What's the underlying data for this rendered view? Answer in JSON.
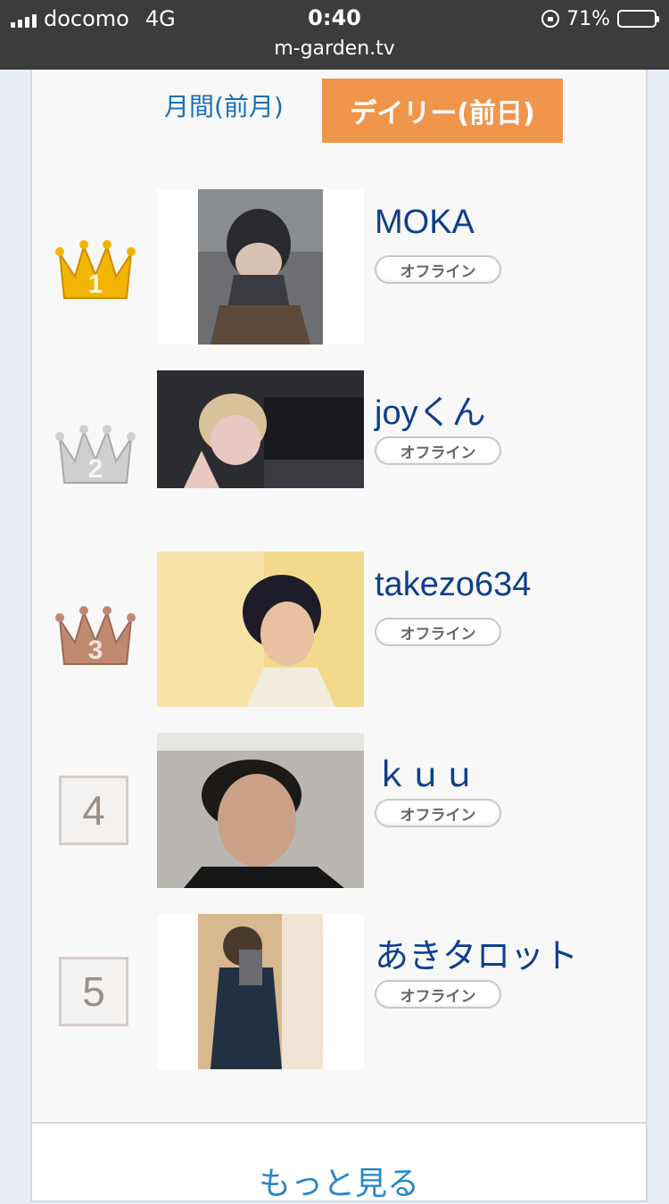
{
  "status_bar": {
    "carrier": "docomo",
    "network": "4G",
    "time": "0:40",
    "battery_percent": "71%",
    "battery_level": 0.71,
    "url": "m-garden.tv"
  },
  "tabs": {
    "monthly_label": "月間(前月)",
    "daily_label": "デイリー(前日)",
    "active_tab": "daily",
    "active_color": "#f0964c"
  },
  "ranking": [
    {
      "rank": "1",
      "name": "MOKA",
      "status": "オフライン",
      "crown_color": "#f3b400",
      "photo": "portrait-masked-man"
    },
    {
      "rank": "2",
      "name": "joyくん",
      "status": "オフライン",
      "crown_color": "#bdbdbd",
      "photo": "blonde-peace-sign"
    },
    {
      "rank": "3",
      "name": "takezo634",
      "status": "オフライン",
      "crown_color": "#b87a5e",
      "photo": "dark-hair-portrait"
    },
    {
      "rank": "4",
      "name": "ｋｕｕ",
      "status": "オフライン",
      "crown_color": null,
      "photo": "bearded-man-selfie"
    },
    {
      "rank": "5",
      "name": "あきタロット",
      "status": "オフライン",
      "crown_color": null,
      "photo": "mirror-selfie"
    }
  ],
  "more": {
    "label": "もっと見る"
  }
}
